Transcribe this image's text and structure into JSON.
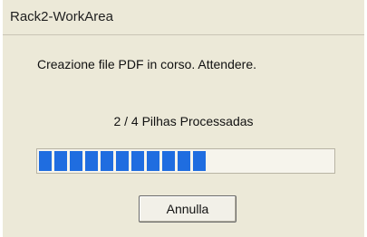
{
  "window": {
    "title": "Rack2-WorkArea"
  },
  "dialog": {
    "message": "Creazione file PDF in corso. Attendere.",
    "progress_text": "2 / 4 Pilhas Processadas",
    "progress_fraction": 0.56,
    "cancel_label": "Annulla"
  },
  "colors": {
    "background": "#ece9d8",
    "progress_bar": "#1f6de0"
  }
}
